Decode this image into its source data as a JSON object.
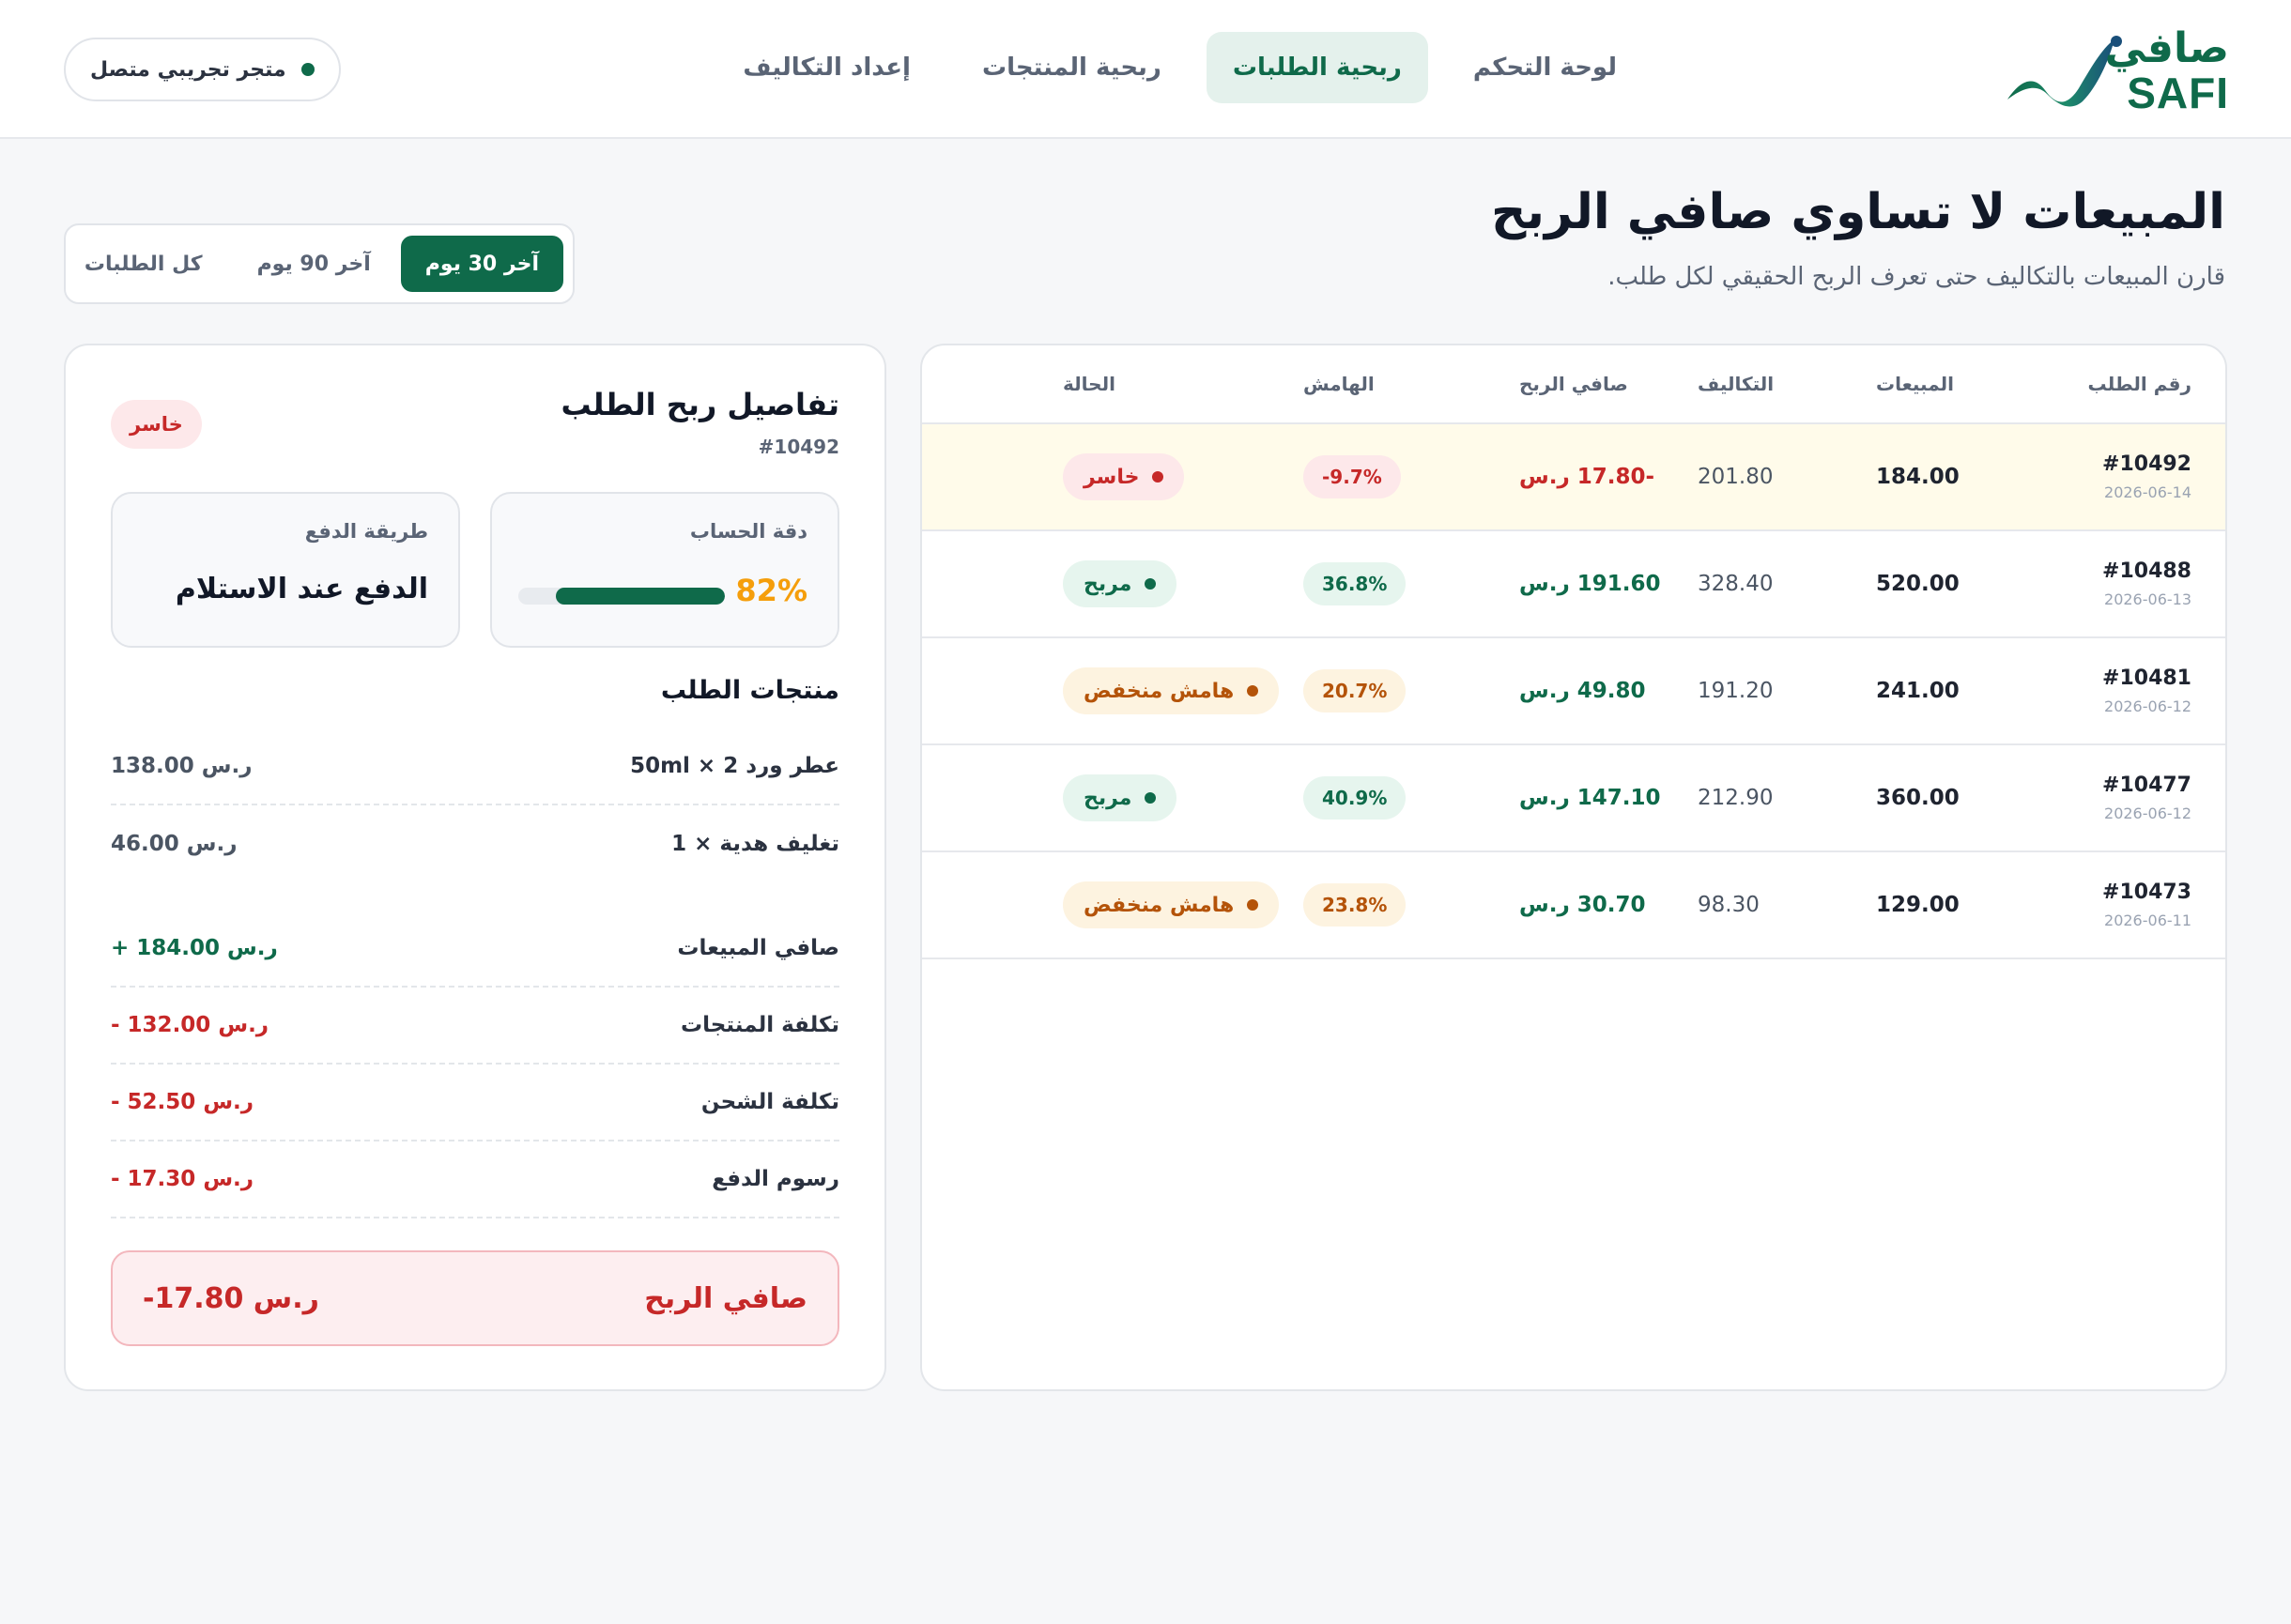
{
  "brand": {
    "name_ar": "صافي",
    "name_en": "SAFI",
    "accent": "#0f6a4a"
  },
  "nav": [
    {
      "label": "لوحة التحكم",
      "active": false
    },
    {
      "label": "ربحية الطلبات",
      "active": true
    },
    {
      "label": "ربحية المنتجات",
      "active": false
    },
    {
      "label": "إعداد التكاليف",
      "active": false
    }
  ],
  "store": {
    "label": "متجر تجريبي متصل",
    "status_color": "#0f6a4a"
  },
  "header": {
    "title": "المبيعات لا تساوي صافي الربح",
    "subtitle": "قارن المبيعات بالتكاليف حتى تعرف الربح الحقيقي لكل طلب."
  },
  "ranges": [
    {
      "label": "آخر 30 يوم",
      "active": true
    },
    {
      "label": "آخر 90 يوم",
      "active": false
    },
    {
      "label": "كل الطلبات",
      "active": false
    }
  ],
  "table": {
    "columns": {
      "id": "رقم الطلب",
      "sales": "المبيعات",
      "cost": "التكاليف",
      "profit": "صافي الربح",
      "margin": "الهامش",
      "status": "الحالة"
    },
    "rows": [
      {
        "id": "#10492",
        "date": "2026-06-14",
        "sales": "184.00",
        "cost": "201.80",
        "profit": "-17.80 ر.س",
        "margin": "-9.7%",
        "status": "خاسر",
        "tone": "neg",
        "selected": true
      },
      {
        "id": "#10488",
        "date": "2026-06-13",
        "sales": "520.00",
        "cost": "328.40",
        "profit": "191.60 ر.س",
        "margin": "36.8%",
        "status": "مربح",
        "tone": "pos",
        "selected": false
      },
      {
        "id": "#10481",
        "date": "2026-06-12",
        "sales": "241.00",
        "cost": "191.20",
        "profit": "49.80 ر.س",
        "margin": "20.7%",
        "status": "هامش منخفض",
        "tone": "warn",
        "selected": false
      },
      {
        "id": "#10477",
        "date": "2026-06-12",
        "sales": "360.00",
        "cost": "212.90",
        "profit": "147.10 ر.س",
        "margin": "40.9%",
        "status": "مربح",
        "tone": "pos",
        "selected": false
      },
      {
        "id": "#10473",
        "date": "2026-06-11",
        "sales": "129.00",
        "cost": "98.30",
        "profit": "30.70 ر.س",
        "margin": "23.8%",
        "status": "هامش منخفض",
        "tone": "warn",
        "selected": false
      }
    ]
  },
  "detail": {
    "title": "تفاصيل ربح الطلب",
    "order_id": "#10492",
    "badge": "خاسر",
    "accuracy": {
      "label": "دقة الحساب",
      "value": "82%",
      "fraction": 0.82
    },
    "payment": {
      "label": "طريقة الدفع",
      "value": "الدفع عند الاستلام"
    },
    "products_title": "منتجات الطلب",
    "products": [
      {
        "name": "عطر ورد 50ml × 2",
        "amount": "138.00 ر.س"
      },
      {
        "name": "تغليف هدية × 1",
        "amount": "46.00 ر.س"
      }
    ],
    "breakdown": [
      {
        "label": "صافي المبيعات",
        "value": "+ 184.00 ر.س",
        "tone": "pos"
      },
      {
        "label": "تكلفة المنتجات",
        "value": "- 132.00 ر.س",
        "tone": "neg"
      },
      {
        "label": "تكلفة الشحن",
        "value": "- 52.50 ر.س",
        "tone": "neg"
      },
      {
        "label": "رسوم الدفع",
        "value": "- 17.30 ر.س",
        "tone": "neg"
      }
    ],
    "net": {
      "label": "صافي الربح",
      "value": "-17.80 ر.س"
    }
  }
}
